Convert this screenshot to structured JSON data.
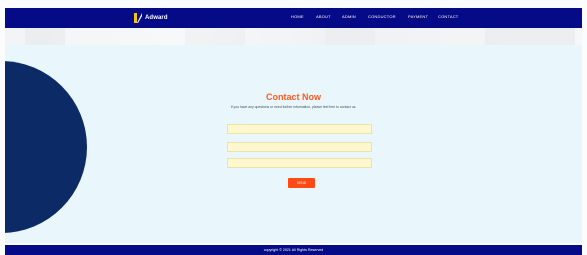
{
  "brand": {
    "name": "Adward",
    "icon": "logo-icon"
  },
  "nav": {
    "items": [
      {
        "label": "HOME"
      },
      {
        "label": "ABOUT"
      },
      {
        "label": "ADMIN"
      },
      {
        "label": "CONDUCTOR"
      },
      {
        "label": "PAYMENT"
      },
      {
        "label": "CONTACT"
      }
    ]
  },
  "contact": {
    "title": "Contact Now",
    "subtitle": "If you have any questions or need further information, please feel free to contact us.",
    "fields": [
      {
        "placeholder": ""
      },
      {
        "placeholder": ""
      },
      {
        "placeholder": ""
      }
    ],
    "send_label": "SEND"
  },
  "footer": {
    "text": "copyright © 2021 All Rights Reserved"
  },
  "colors": {
    "nav_bg": "#050a86",
    "accent": "#ff5a1f",
    "button": "#ff4a14",
    "panel_bg": "#e9f6fc",
    "semicircle": "#0b2a66",
    "field_bg": "#fff8cf"
  }
}
